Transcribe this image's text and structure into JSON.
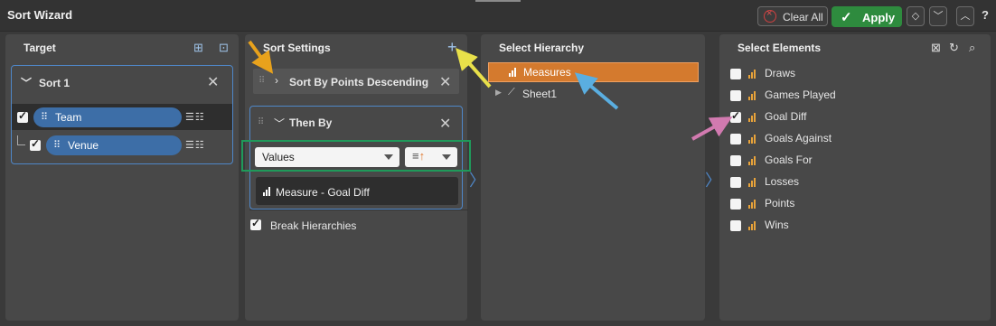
{
  "window": {
    "title": "Sort Wizard"
  },
  "toolbar": {
    "clear_all": "Clear All",
    "apply": "Apply",
    "help": "?"
  },
  "target": {
    "title": "Target",
    "sort": {
      "label": "Sort 1"
    },
    "fields": [
      {
        "label": "Team",
        "checked": true
      },
      {
        "label": "Venue",
        "checked": true
      }
    ]
  },
  "sort_settings": {
    "title": "Sort Settings",
    "primary": "Sort By Points Descending",
    "then_by": "Then By",
    "sort_source": "Values",
    "sort_direction_icon": "sort-ascending-icon",
    "measure": "Measure - Goal Diff",
    "break_hierarchies": "Break Hierarchies",
    "break_hierarchies_checked": true
  },
  "hierarchy": {
    "title": "Select Hierarchy",
    "items": [
      {
        "label": "Measures",
        "selected": true
      },
      {
        "label": "Sheet1",
        "selected": false
      }
    ]
  },
  "elements": {
    "title": "Select Elements",
    "items": [
      {
        "label": "Draws",
        "checked": false
      },
      {
        "label": "Games Played",
        "checked": false
      },
      {
        "label": "Goal Diff",
        "checked": true
      },
      {
        "label": "Goals Against",
        "checked": false
      },
      {
        "label": "Goals For",
        "checked": false
      },
      {
        "label": "Losses",
        "checked": false
      },
      {
        "label": "Points",
        "checked": false
      },
      {
        "label": "Wins",
        "checked": false
      }
    ]
  },
  "colors": {
    "accent_blue": "#4f87c8",
    "selected_orange": "#d47a2e",
    "apply_green": "#2e8b3e",
    "measure_icon": "#e8a33a"
  }
}
